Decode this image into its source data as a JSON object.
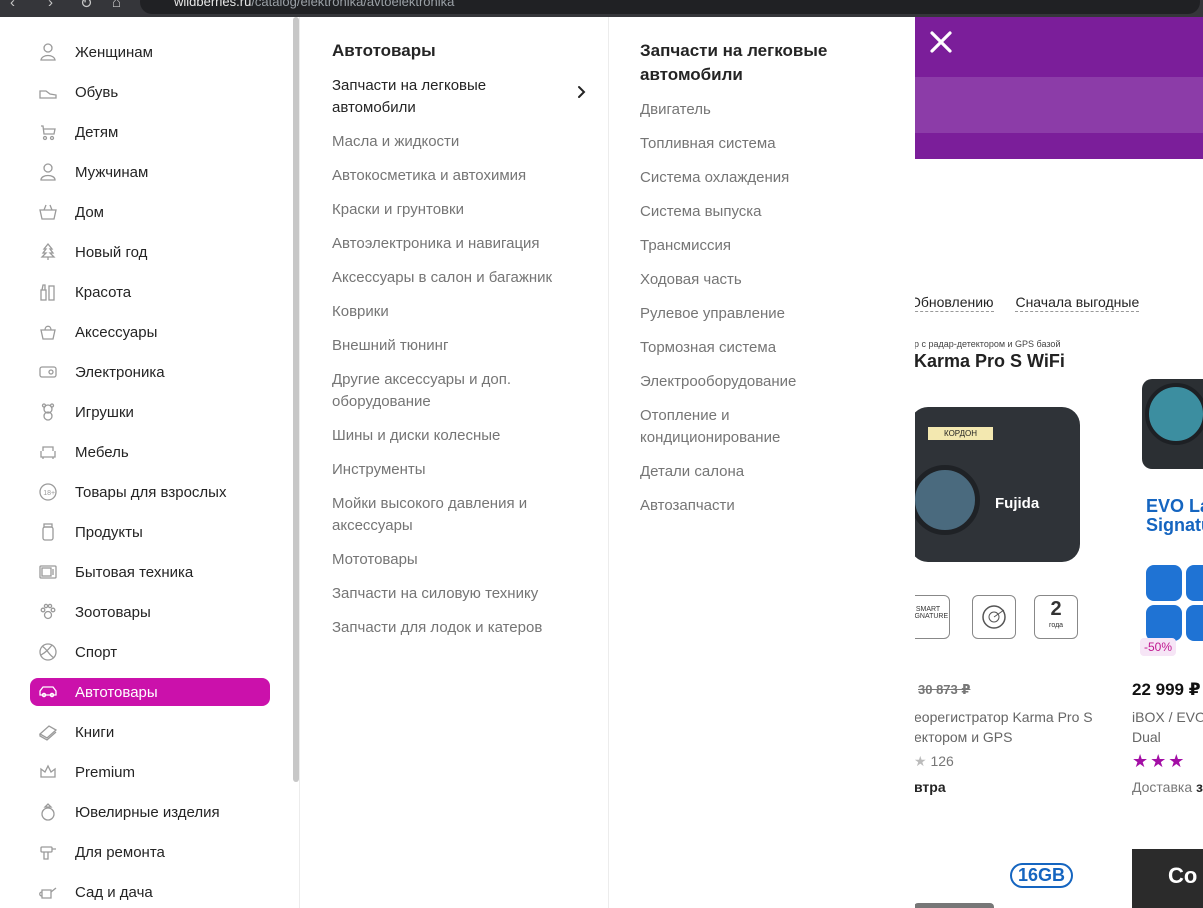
{
  "browser": {
    "url_host": "wildberries.ru",
    "url_path": "/catalog/elektronika/avtoelektronika"
  },
  "sidebar": {
    "items": [
      {
        "label": "Женщинам",
        "icon": "woman-icon"
      },
      {
        "label": "Обувь",
        "icon": "shoe-icon"
      },
      {
        "label": "Детям",
        "icon": "stroller-icon"
      },
      {
        "label": "Мужчинам",
        "icon": "man-icon"
      },
      {
        "label": "Дом",
        "icon": "basket-icon"
      },
      {
        "label": "Новый год",
        "icon": "christmas-tree-icon"
      },
      {
        "label": "Красота",
        "icon": "cosmetics-icon"
      },
      {
        "label": "Аксессуары",
        "icon": "bag-icon"
      },
      {
        "label": "Электроника",
        "icon": "device-icon"
      },
      {
        "label": "Игрушки",
        "icon": "teddy-bear-icon"
      },
      {
        "label": "Мебель",
        "icon": "sofa-icon"
      },
      {
        "label": "Товары для взрослых",
        "icon": "adult-18-icon"
      },
      {
        "label": "Продукты",
        "icon": "jar-icon"
      },
      {
        "label": "Бытовая техника",
        "icon": "microwave-icon"
      },
      {
        "label": "Зоотовары",
        "icon": "paw-icon"
      },
      {
        "label": "Спорт",
        "icon": "ball-icon"
      },
      {
        "label": "Автотовары",
        "icon": "car-icon"
      },
      {
        "label": "Книги",
        "icon": "book-icon"
      },
      {
        "label": "Premium",
        "icon": "crown-icon"
      },
      {
        "label": "Ювелирные изделия",
        "icon": "ring-icon"
      },
      {
        "label": "Для ремонта",
        "icon": "drill-icon"
      },
      {
        "label": "Сад и дача",
        "icon": "watering-can-icon"
      }
    ],
    "active_index": 16,
    "active_color": "#cb11ab"
  },
  "subcategory": {
    "title": "Автотовары",
    "items": [
      "Запчасти на легковые автомобили",
      "Масла и жидкости",
      "Автокосметика и автохимия",
      "Краски и грунтовки",
      "Автоэлектроника и навигация",
      "Аксессуары в салон и багажник",
      "Коврики",
      "Внешний тюнинг",
      "Другие аксессуары и доп. оборудование",
      "Шины и диски колесные",
      "Инструменты",
      "Мойки высокого давления и аксессуары",
      "Мототовары",
      "Запчасти на силовую технику",
      "Запчасти для лодок и катеров"
    ],
    "active_index": 0
  },
  "detail": {
    "title": "Запчасти на легковые автомобили",
    "items": [
      "Двигатель",
      "Топливная система",
      "Система охлаждения",
      "Система выпуска",
      "Трансмиссия",
      "Ходовая часть",
      "Рулевое управление",
      "Тормозная система",
      "Электрооборудование",
      "Отопление и кондиционирование",
      "Детали салона",
      "Автозапчасти"
    ]
  },
  "background_page": {
    "header_color": "#7b1e9a",
    "sort_links": [
      "Обновлению",
      "Сначала выгодные"
    ],
    "product1": {
      "subtitle": "р с радар-детектором и GPS базой",
      "name": "Karma Pro S WiFi",
      "brand": "Fujida",
      "tag": "КОРДОН",
      "badge_smart": "SMART SIGNATURE",
      "badge_years": "2",
      "badge_years_unit": "года",
      "old_price": "30 873 ₽",
      "desc_line1": "еорегистратор Karma Pro S",
      "desc_line2": "ектором и GPS",
      "rating_count": "126",
      "delivery": "втра"
    },
    "product2": {
      "name_line1": "EVO La",
      "name_line2": "Signatu",
      "discount": "-50%",
      "price": "22 999 ₽",
      "desc_line1": "iBOX / EVO",
      "desc_line2": "Dual",
      "stars": "★★★",
      "delivery_label": "Доставка",
      "delivery_value": "з"
    },
    "sd_card": "16GB",
    "dark_tile_text": "Co"
  }
}
